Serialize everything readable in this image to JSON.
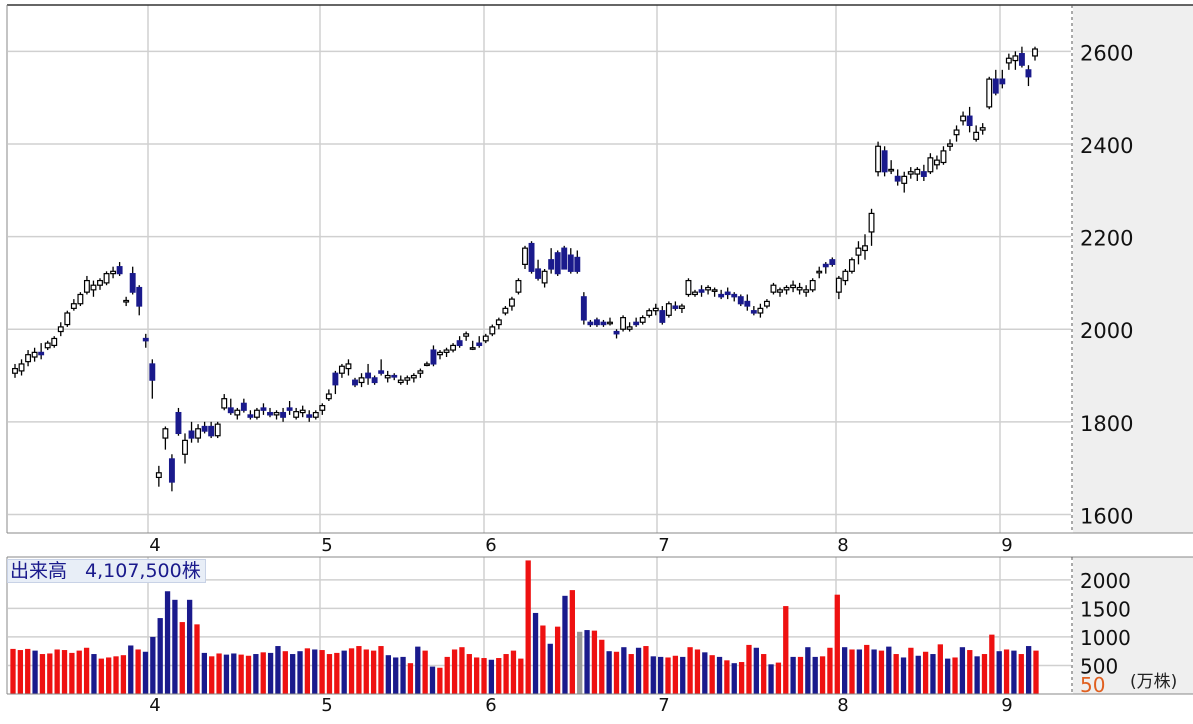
{
  "chart_data": [
    {
      "type": "candlestick",
      "x_tick_labels": [
        "4",
        "5",
        "6",
        "7",
        "8",
        "9"
      ],
      "y_tick_labels": [
        "1600",
        "1800",
        "2000",
        "2200",
        "2400",
        "2600"
      ],
      "ylim": [
        1560,
        2700
      ],
      "grid": true,
      "up_color": "#ffffff",
      "down_color": "#1a1a8c",
      "ohlc": [
        [
          1905,
          1925,
          1895,
          1915
        ],
        [
          1910,
          1935,
          1900,
          1925
        ],
        [
          1930,
          1955,
          1920,
          1945
        ],
        [
          1940,
          1960,
          1930,
          1950
        ],
        [
          1950,
          1970,
          1935,
          1945
        ],
        [
          1960,
          1975,
          1955,
          1970
        ],
        [
          1965,
          1985,
          1960,
          1980
        ],
        [
          1995,
          2015,
          1985,
          2005
        ],
        [
          2010,
          2040,
          2005,
          2035
        ],
        [
          2045,
          2065,
          2040,
          2055
        ],
        [
          2055,
          2080,
          2050,
          2075
        ],
        [
          2080,
          2115,
          2075,
          2105
        ],
        [
          2085,
          2105,
          2070,
          2095
        ],
        [
          2095,
          2110,
          2085,
          2105
        ],
        [
          2100,
          2125,
          2095,
          2120
        ],
        [
          2120,
          2135,
          2110,
          2125
        ],
        [
          2135,
          2145,
          2115,
          2120
        ],
        [
          2060,
          2070,
          2050,
          2062
        ],
        [
          2120,
          2135,
          2075,
          2080
        ],
        [
          2090,
          2095,
          2030,
          2050
        ],
        [
          1980,
          1990,
          1960,
          1975
        ],
        [
          1925,
          1935,
          1850,
          1890
        ],
        [
          1680,
          1705,
          1660,
          1690
        ],
        [
          1765,
          1790,
          1740,
          1785
        ],
        [
          1720,
          1730,
          1650,
          1670
        ],
        [
          1820,
          1830,
          1770,
          1775
        ],
        [
          1730,
          1775,
          1710,
          1760
        ],
        [
          1780,
          1800,
          1755,
          1765
        ],
        [
          1765,
          1795,
          1755,
          1785
        ],
        [
          1790,
          1800,
          1775,
          1780
        ],
        [
          1790,
          1800,
          1765,
          1770
        ],
        [
          1770,
          1800,
          1765,
          1795
        ],
        [
          1830,
          1860,
          1825,
          1850
        ],
        [
          1830,
          1850,
          1815,
          1820
        ],
        [
          1815,
          1830,
          1805,
          1825
        ],
        [
          1840,
          1850,
          1820,
          1825
        ],
        [
          1815,
          1825,
          1805,
          1810
        ],
        [
          1810,
          1830,
          1805,
          1825
        ],
        [
          1830,
          1840,
          1815,
          1825
        ],
        [
          1820,
          1830,
          1810,
          1815
        ],
        [
          1815,
          1825,
          1805,
          1820
        ],
        [
          1820,
          1830,
          1800,
          1810
        ],
        [
          1830,
          1845,
          1815,
          1825
        ],
        [
          1810,
          1830,
          1805,
          1822
        ],
        [
          1820,
          1835,
          1810,
          1825
        ],
        [
          1815,
          1825,
          1800,
          1810
        ],
        [
          1810,
          1825,
          1805,
          1820
        ],
        [
          1825,
          1840,
          1815,
          1835
        ],
        [
          1850,
          1870,
          1845,
          1860
        ],
        [
          1905,
          1910,
          1860,
          1880
        ],
        [
          1905,
          1925,
          1895,
          1920
        ],
        [
          1915,
          1935,
          1900,
          1925
        ],
        [
          1890,
          1895,
          1875,
          1880
        ],
        [
          1885,
          1905,
          1875,
          1895
        ],
        [
          1905,
          1925,
          1880,
          1895
        ],
        [
          1895,
          1900,
          1880,
          1885
        ],
        [
          1910,
          1935,
          1900,
          1905
        ],
        [
          1895,
          1910,
          1885,
          1900
        ],
        [
          1900,
          1905,
          1890,
          1898
        ],
        [
          1885,
          1900,
          1880,
          1890
        ],
        [
          1890,
          1900,
          1880,
          1895
        ],
        [
          1895,
          1905,
          1885,
          1900
        ],
        [
          1905,
          1915,
          1895,
          1910
        ],
        [
          1925,
          1930,
          1920,
          1925
        ],
        [
          1955,
          1965,
          1920,
          1925
        ],
        [
          1945,
          1955,
          1935,
          1950
        ],
        [
          1950,
          1960,
          1940,
          1955
        ],
        [
          1955,
          1970,
          1950,
          1965
        ],
        [
          1975,
          1985,
          1960,
          1965
        ],
        [
          1985,
          1995,
          1975,
          1990
        ],
        [
          1960,
          1975,
          1955,
          1960
        ],
        [
          1970,
          1985,
          1960,
          1965
        ],
        [
          1975,
          1990,
          1970,
          1985
        ],
        [
          1990,
          2010,
          1985,
          2005
        ],
        [
          2010,
          2025,
          2000,
          2020
        ],
        [
          2035,
          2050,
          2030,
          2045
        ],
        [
          2050,
          2070,
          2040,
          2065
        ],
        [
          2080,
          2110,
          2075,
          2105
        ],
        [
          2140,
          2180,
          2130,
          2175
        ],
        [
          2185,
          2190,
          2120,
          2125
        ],
        [
          2130,
          2150,
          2105,
          2110
        ],
        [
          2100,
          2130,
          2090,
          2125
        ],
        [
          2150,
          2175,
          2120,
          2130
        ],
        [
          2165,
          2170,
          2115,
          2120
        ],
        [
          2175,
          2180,
          2130,
          2130
        ],
        [
          2160,
          2175,
          2120,
          2125
        ],
        [
          2155,
          2170,
          2120,
          2125
        ],
        [
          2070,
          2080,
          2010,
          2020
        ],
        [
          2015,
          2020,
          2005,
          2010
        ],
        [
          2020,
          2025,
          2005,
          2010
        ],
        [
          2015,
          2020,
          2005,
          2010
        ],
        [
          2015,
          2025,
          2008,
          2015
        ],
        [
          1995,
          2000,
          1980,
          1990
        ],
        [
          2000,
          2030,
          1995,
          2025
        ],
        [
          2000,
          2015,
          1995,
          2005
        ],
        [
          2015,
          2025,
          2005,
          2010
        ],
        [
          2015,
          2030,
          2010,
          2025
        ],
        [
          2030,
          2045,
          2025,
          2040
        ],
        [
          2040,
          2055,
          2030,
          2045
        ],
        [
          2040,
          2050,
          2010,
          2015
        ],
        [
          2030,
          2060,
          2025,
          2055
        ],
        [
          2050,
          2060,
          2040,
          2045
        ],
        [
          2045,
          2055,
          2035,
          2050
        ],
        [
          2075,
          2110,
          2070,
          2105
        ],
        [
          2075,
          2085,
          2070,
          2080
        ],
        [
          2085,
          2095,
          2070,
          2080
        ],
        [
          2085,
          2095,
          2075,
          2090
        ],
        [
          2085,
          2090,
          2070,
          2085
        ],
        [
          2075,
          2085,
          2065,
          2070
        ],
        [
          2080,
          2090,
          2065,
          2075
        ],
        [
          2075,
          2080,
          2060,
          2070
        ],
        [
          2070,
          2075,
          2050,
          2055
        ],
        [
          2060,
          2075,
          2040,
          2050
        ],
        [
          2040,
          2050,
          2030,
          2035
        ],
        [
          2035,
          2055,
          2025,
          2045
        ],
        [
          2050,
          2065,
          2045,
          2060
        ],
        [
          2080,
          2100,
          2075,
          2095
        ],
        [
          2080,
          2090,
          2070,
          2085
        ],
        [
          2085,
          2095,
          2075,
          2090
        ],
        [
          2090,
          2105,
          2080,
          2095
        ],
        [
          2085,
          2100,
          2075,
          2090
        ],
        [
          2080,
          2095,
          2070,
          2085
        ],
        [
          2085,
          2110,
          2080,
          2105
        ],
        [
          2125,
          2135,
          2110,
          2125
        ],
        [
          2140,
          2145,
          2120,
          2135
        ],
        [
          2150,
          2155,
          2135,
          2140
        ],
        [
          2080,
          2115,
          2065,
          2110
        ],
        [
          2105,
          2130,
          2095,
          2125
        ],
        [
          2125,
          2155,
          2120,
          2150
        ],
        [
          2160,
          2190,
          2140,
          2175
        ],
        [
          2170,
          2205,
          2150,
          2180
        ],
        [
          2210,
          2260,
          2180,
          2250
        ],
        [
          2340,
          2405,
          2330,
          2395
        ],
        [
          2385,
          2395,
          2330,
          2340
        ],
        [
          2345,
          2365,
          2335,
          2345
        ],
        [
          2330,
          2345,
          2310,
          2320
        ],
        [
          2315,
          2340,
          2295,
          2330
        ],
        [
          2335,
          2350,
          2325,
          2340
        ],
        [
          2335,
          2350,
          2320,
          2345
        ],
        [
          2340,
          2355,
          2320,
          2330
        ],
        [
          2340,
          2380,
          2335,
          2370
        ],
        [
          2355,
          2375,
          2345,
          2365
        ],
        [
          2360,
          2395,
          2355,
          2385
        ],
        [
          2395,
          2410,
          2385,
          2400
        ],
        [
          2420,
          2440,
          2405,
          2430
        ],
        [
          2450,
          2470,
          2440,
          2460
        ],
        [
          2460,
          2480,
          2425,
          2440
        ],
        [
          2410,
          2440,
          2405,
          2425
        ],
        [
          2430,
          2445,
          2420,
          2435
        ],
        [
          2480,
          2545,
          2475,
          2540
        ],
        [
          2540,
          2560,
          2505,
          2510
        ],
        [
          2540,
          2560,
          2520,
          2530
        ],
        [
          2575,
          2595,
          2560,
          2585
        ],
        [
          2580,
          2600,
          2560,
          2590
        ],
        [
          2595,
          2610,
          2565,
          2570
        ],
        [
          2560,
          2570,
          2525,
          2545
        ],
        [
          2590,
          2610,
          2580,
          2605
        ]
      ],
      "colors": {
        "volume_up": "#ee1111",
        "volume_down": "#1a1a8c",
        "volume_flat": "#999999",
        "grid": "#d0d0d0",
        "axis_panel": "#efefef"
      }
    },
    {
      "type": "bar",
      "title": "出来高",
      "value_label": "4,107,500株",
      "unit_label": "(万株)",
      "x_tick_labels": [
        "4",
        "5",
        "6",
        "7",
        "8",
        "9"
      ],
      "y_tick_labels": [
        "2000",
        "1500",
        "1000",
        "500"
      ],
      "y_extra_label": "50",
      "ylim": [
        0,
        2400
      ],
      "values": [
        790,
        770,
        790,
        760,
        700,
        710,
        780,
        770,
        720,
        760,
        810,
        700,
        620,
        640,
        660,
        680,
        850,
        780,
        740,
        1000,
        1330,
        1800,
        1650,
        1260,
        1650,
        1220,
        720,
        660,
        710,
        690,
        710,
        690,
        670,
        700,
        730,
        720,
        840,
        750,
        700,
        750,
        800,
        780,
        770,
        700,
        720,
        760,
        800,
        840,
        780,
        760,
        840,
        680,
        640,
        650,
        540,
        830,
        760,
        480,
        460,
        650,
        780,
        820,
        700,
        640,
        630,
        600,
        630,
        700,
        760,
        620,
        2340,
        1420,
        1200,
        880,
        1180,
        1720,
        1820,
        1090,
        1120,
        1110,
        950,
        750,
        740,
        820,
        700,
        810,
        840,
        660,
        650,
        640,
        670,
        650,
        820,
        780,
        730,
        680,
        650,
        590,
        540,
        560,
        860,
        810,
        700,
        520,
        550,
        1540,
        650,
        650,
        820,
        650,
        660,
        810,
        1740,
        820,
        780,
        780,
        860,
        780,
        760,
        830,
        700,
        640,
        810,
        670,
        740,
        700,
        870,
        620,
        640,
        820,
        770,
        660,
        700,
        1040,
        750,
        780,
        760,
        700,
        840,
        760
      ],
      "directions": [
        "u",
        "u",
        "u",
        "d",
        "u",
        "u",
        "u",
        "u",
        "u",
        "u",
        "u",
        "d",
        "u",
        "u",
        "u",
        "u",
        "d",
        "u",
        "d",
        "d",
        "d",
        "d",
        "d",
        "u",
        "d",
        "u",
        "d",
        "u",
        "u",
        "d",
        "d",
        "u",
        "u",
        "d",
        "u",
        "d",
        "d",
        "u",
        "d",
        "d",
        "u",
        "d",
        "u",
        "u",
        "u",
        "d",
        "u",
        "u",
        "u",
        "u",
        "u",
        "d",
        "d",
        "d",
        "u",
        "d",
        "u",
        "d",
        "u",
        "u",
        "u",
        "u",
        "u",
        "u",
        "u",
        "d",
        "u",
        "u",
        "u",
        "u",
        "u",
        "d",
        "u",
        "d",
        "u",
        "d",
        "u",
        "f",
        "d",
        "u",
        "u",
        "d",
        "u",
        "d",
        "u",
        "d",
        "u",
        "d",
        "d",
        "u",
        "u",
        "d",
        "u",
        "u",
        "d",
        "u",
        "d",
        "u",
        "d",
        "u",
        "u",
        "d",
        "u",
        "d",
        "u",
        "u",
        "d",
        "u",
        "d",
        "d",
        "u",
        "u",
        "u",
        "d",
        "u",
        "d",
        "u",
        "d",
        "u",
        "d",
        "u",
        "d",
        "u",
        "d",
        "u",
        "d",
        "u",
        "d",
        "u",
        "d",
        "u",
        "d",
        "u",
        "u",
        "d",
        "u",
        "d",
        "u",
        "d",
        "u"
      ]
    }
  ]
}
